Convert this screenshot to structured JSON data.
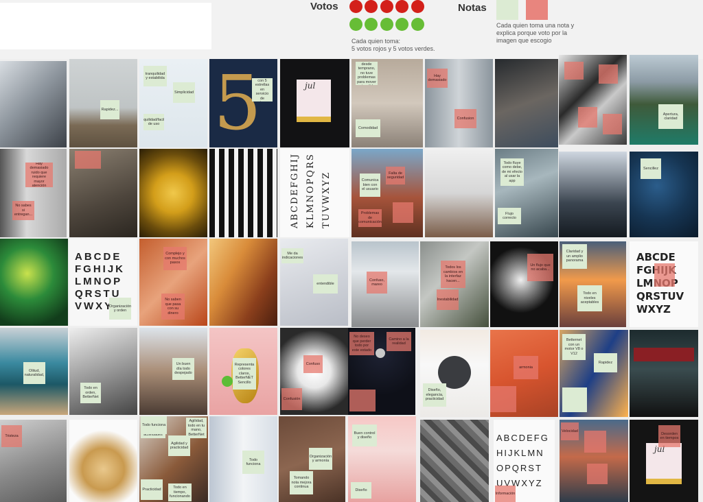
{
  "header": {
    "votes_label": "Votos",
    "notes_label": "Notas",
    "votes_caption_1": "Cada quien toma:",
    "votes_caption_2": "5 votos rojos y 5 votos verdes.",
    "notes_caption_1": "Cada quien toma una nota  y",
    "notes_caption_2": "explica porque voto por la",
    "notes_caption_3": "imagen que escogio",
    "colors": {
      "red": "#d3201a",
      "green": "#67bd36",
      "note_green": "#dcebd3",
      "note_red": "#e8857e"
    }
  },
  "board": {
    "notes": {
      "n1": "Rapidez...",
      "n2": "tranquilidad y estabilida",
      "n3": "Simplicidad",
      "n4": "Tranquilidad/facilidad de uso",
      "n5": "calificquí con 5 estrellas en servicio de entrega",
      "n6": "Descanso desde temprano, no tuve problemas para mover mi pedido",
      "n7": "Comodidad",
      "n8": "Hay demasiado",
      "n9": "Confusion",
      "n10": "Apertura, claridad",
      "n11": "Hay demasiado ruido que requiere mayor atención",
      "n12": "No sabes si entregan...",
      "n13": "Comunica bien con el usuario",
      "n14": "Falta de seguridad",
      "n15": "Problemas de comunicación",
      "n16": "Todo fluye como debe, de mi efecto al usar la app",
      "n17": "Flujo correcto",
      "n18": "Sencillez",
      "n19": "Complejo y con muchos pasos",
      "n20": "No saben que pasa con su dinero",
      "n21": "Me da indicaciones",
      "n22": "entendible",
      "n23": "Confuso, mareo",
      "n24": "Todos los cambios en la interfaz hacen...",
      "n25": "Inestabilidad",
      "n26": "Un flujo que no acaba...",
      "n27": "Claridad y un amplio panorama",
      "n28": "Todo en niveles aceptables",
      "n29": "Organización y orden",
      "n30": "Olitud, naturalidad,",
      "n31": "Todo en orden, BetterNet",
      "n32": "Un buen día todo despejado",
      "n33": "Representa colores claros, BetterNET Sencillo",
      "n34": "Confuso",
      "n35": "Confusión",
      "n36": "No deseo que perder todo por este estado",
      "n37": "Camino a la realidad",
      "n38": "Diseño, elegancia, practicidad",
      "n39": "armonia",
      "n40": "Betternet con un motor V8 o V12",
      "n41": "Rapidez",
      "n42": "Tristeza",
      "n43": "Tuve más tiempo para otras actividades",
      "n44": "Agilidad, todo en tu mano, BetterNet",
      "n45": "Agilidad y practicidad",
      "n46": "Todo funciona",
      "n47": "Practicidad",
      "n48": "Todo en tiempo, funcionando",
      "n49": "Todo funciona",
      "n50": "Organización y armonía",
      "n51": "Tomando nota mejora continua",
      "n52": "Buen control y diseño",
      "n53": "Diseño",
      "n54": "Información",
      "n55": "Velocidad",
      "n56": "Desorden en tiempos"
    },
    "alphabet_serif": "ABCDEFGHIJ KLMNOPQRS TUVWXYZ",
    "alpha_rows_a": [
      "ABCDEFG",
      "HIJKLMN",
      "OPQRST",
      "UVWXYZ"
    ],
    "alpha_rows_b": [
      "ABCDE",
      "FGHIJK",
      "LMNOP",
      "QRSTU",
      "VWXYZ"
    ],
    "alpha_rows_c": [
      "ABCDE",
      "FGHIJK",
      "LMNOP",
      "QRSTUV",
      "WXYZ"
    ],
    "cal_label": "jul",
    "number": "5"
  }
}
